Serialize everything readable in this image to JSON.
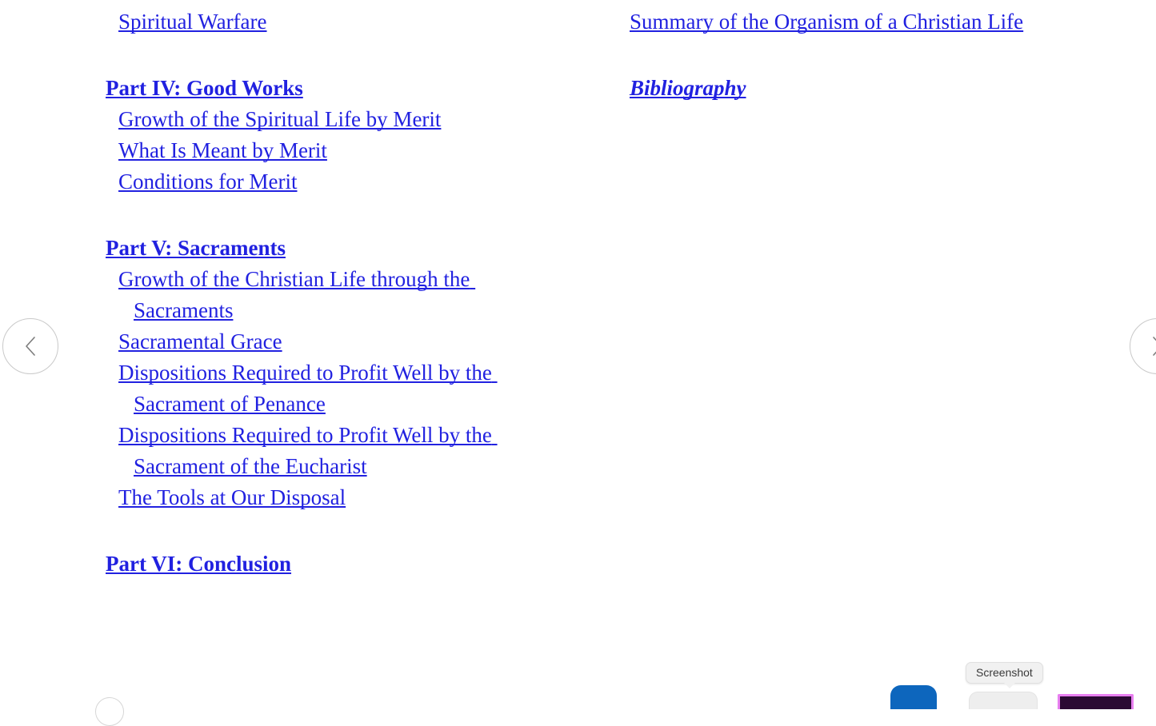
{
  "document": {
    "type": "table-of-contents",
    "link_color": "#2121e0",
    "background_color": "#ffffff",
    "left_column": [
      {
        "kind": "item",
        "label": "Spiritual Warfare"
      },
      {
        "kind": "spacer"
      },
      {
        "kind": "heading",
        "label": "Part IV: Good Works"
      },
      {
        "kind": "item",
        "label": "Growth of the Spiritual Life by Merit"
      },
      {
        "kind": "item",
        "label": "What Is Meant by Merit"
      },
      {
        "kind": "item",
        "label": "Conditions for Merit"
      },
      {
        "kind": "spacer"
      },
      {
        "kind": "heading",
        "label": "Part V: Sacraments"
      },
      {
        "kind": "item",
        "label": "Growth of the Christian Life through the Sacraments"
      },
      {
        "kind": "item",
        "label": "Sacramental Grace"
      },
      {
        "kind": "item",
        "label": "Dispositions Required to Profit Well by the Sacrament of Penance"
      },
      {
        "kind": "item",
        "label": "Dispositions Required to Profit Well by the Sacrament of the Eucharist"
      },
      {
        "kind": "item",
        "label": "The Tools at Our Disposal"
      },
      {
        "kind": "spacer"
      },
      {
        "kind": "heading",
        "label": "Part VI: Conclusion"
      }
    ],
    "right_column": [
      {
        "kind": "item",
        "label": "Summary of the Organism of a Christian Life"
      },
      {
        "kind": "spacer"
      },
      {
        "kind": "italic",
        "label": "Bibliography"
      }
    ]
  },
  "navigation": {
    "previous_page_icon": "chevron-left-icon",
    "next_page_icon": "chevron-right-icon",
    "bottom_control_icon": "circle-button-icon"
  },
  "overlay": {
    "tooltip_label": "Screenshot"
  },
  "dock": {
    "items": [
      {
        "name": "blue-app-indicator",
        "color": "#0d66bd"
      },
      {
        "name": "gray-control",
        "color": "#eeeeee"
      },
      {
        "name": "magenta-window-thumb",
        "color": "#2b0a33",
        "border_color": "#e87ff0"
      }
    ]
  }
}
